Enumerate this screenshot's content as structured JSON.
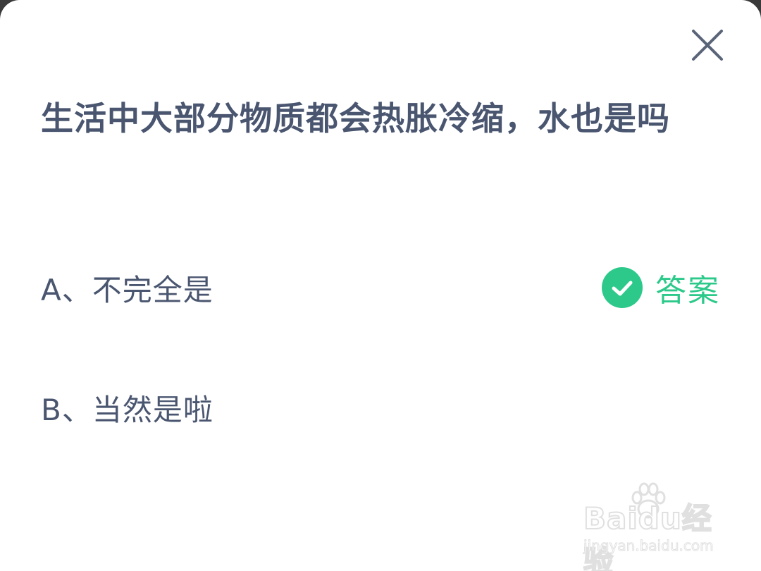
{
  "question": {
    "text": "生活中大部分物质都会热胀冷缩，水也是吗"
  },
  "options": [
    {
      "text": "A、不完全是",
      "is_answer": true
    },
    {
      "text": "B、当然是啦",
      "is_answer": false
    }
  ],
  "answer_tag": {
    "label": "答案",
    "icon": "check-circle-icon",
    "color": "#2cc98a"
  },
  "close": {
    "icon": "close-icon"
  },
  "watermark": {
    "logo_text": "Baidu经验",
    "url": "jingyan.baidu.com"
  },
  "colors": {
    "text": "#4a5670",
    "accent": "#2cc98a",
    "background": "#ffffff"
  }
}
